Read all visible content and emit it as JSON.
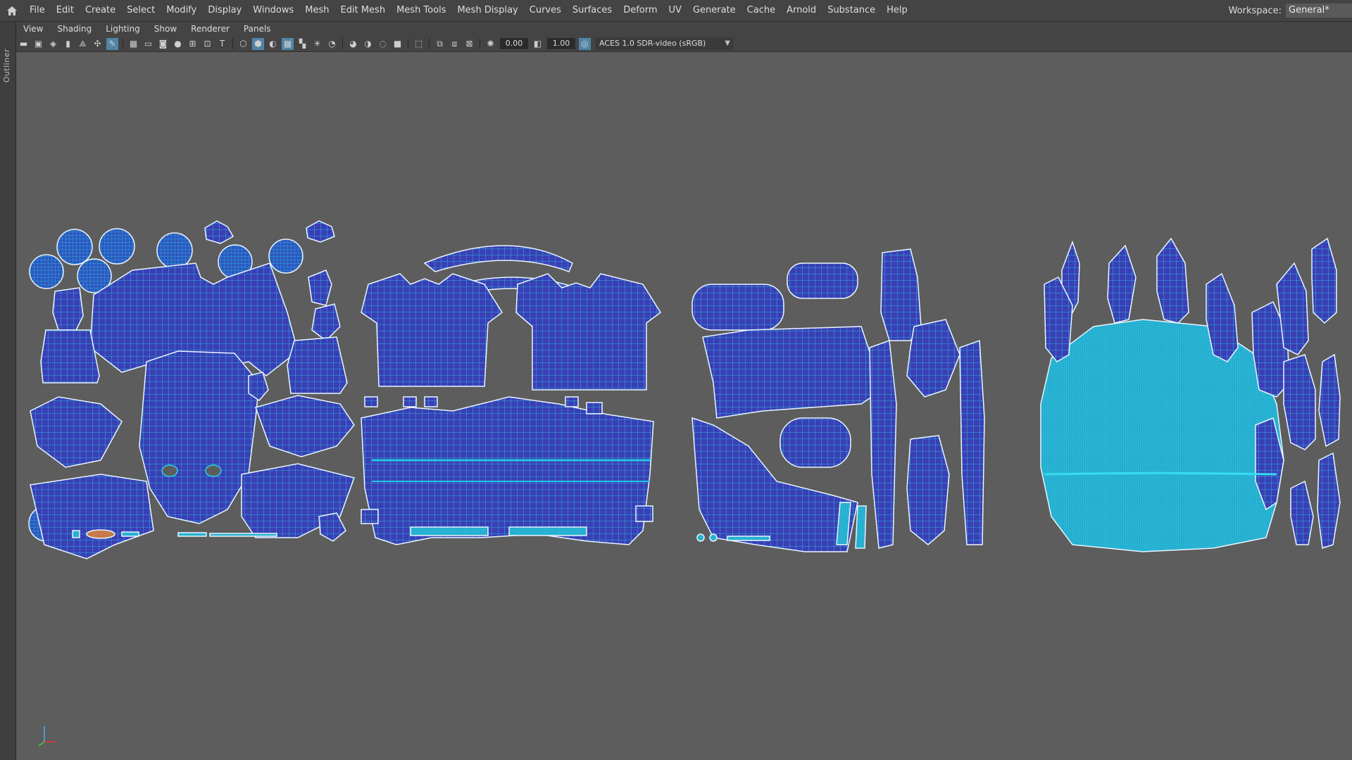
{
  "menubar": {
    "items": [
      "File",
      "Edit",
      "Create",
      "Select",
      "Modify",
      "Display",
      "Windows",
      "Mesh",
      "Edit Mesh",
      "Mesh Tools",
      "Mesh Display",
      "Curves",
      "Surfaces",
      "Deform",
      "UV",
      "Generate",
      "Cache",
      "Arnold",
      "Substance",
      "Help"
    ],
    "workspace_label": "Workspace:",
    "workspace_value": "General*"
  },
  "outliner": {
    "label": "Outliner"
  },
  "panel": {
    "menus": [
      "View",
      "Shading",
      "Lighting",
      "Show",
      "Renderer",
      "Panels"
    ],
    "exposure": "0.00",
    "gamma": "1.00",
    "colorspace": "ACES 1.0 SDR-video (sRGB)"
  },
  "viewport": {
    "uv_fill": "#3a3fb5",
    "uv_border": "#2bd0e8",
    "uv_dense": "#20b8d4",
    "gizmo_y_color": "#3cb0ff",
    "gizmo_x_color": "#e33",
    "gizmo_z_color": "#4c4"
  }
}
